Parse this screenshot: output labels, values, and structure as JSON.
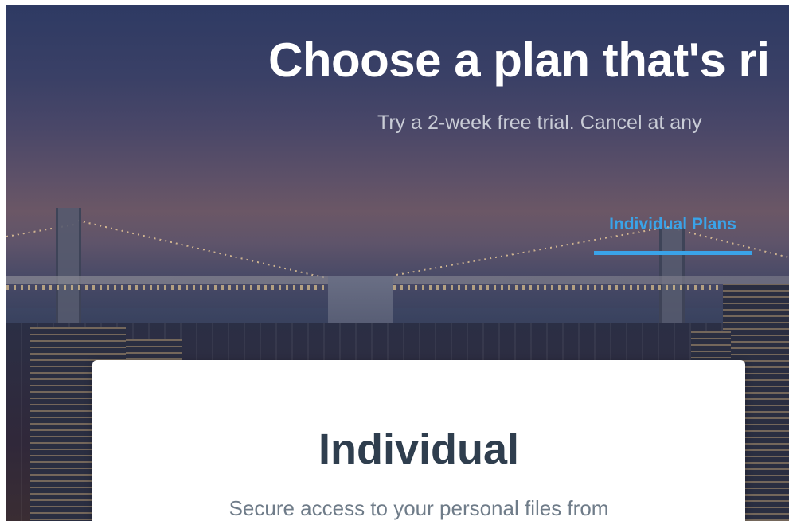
{
  "hero": {
    "headline": "Choose a plan that's ri",
    "subheadline": "Try a 2-week free trial. Cancel at any"
  },
  "tabs": {
    "active_label": "Individual Plans",
    "accent_color": "#3aa3e8"
  },
  "plan_card": {
    "title": "Individual",
    "description": "Secure access to your personal files from"
  }
}
